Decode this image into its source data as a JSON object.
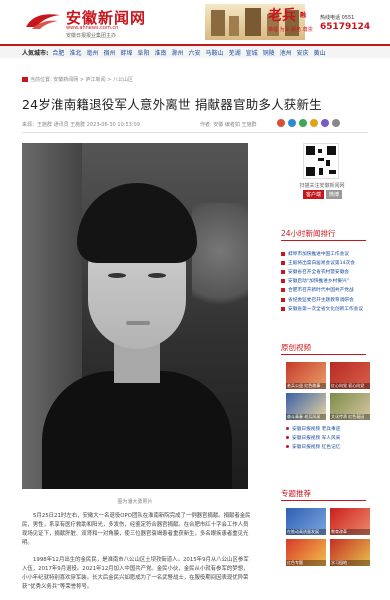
{
  "header": {
    "logo_title": "安徽新闻网",
    "logo_url": "www.ahnews.com.cn",
    "logo_sub": "安徽日报报业集团主办",
    "brand": "老兵",
    "brand_small": "融",
    "brand_sub": "荣福 为军 服务 尊崇",
    "hotline_label": "热线电话 0551",
    "hotline_number": "65179124",
    "accent_color": "#c8161d"
  },
  "region_bar": {
    "label": "人気城市:",
    "items": [
      "合肥",
      "淮北",
      "亳州",
      "宿州",
      "蚌埠",
      "阜阳",
      "淮南",
      "滁州",
      "六安",
      "马鞍山",
      "芜湖",
      "宣城",
      "铜陵",
      "池州",
      "安庆",
      "黄山"
    ]
  },
  "breadcrumb": "当前位置: 安徽新闻网 > 庐江新闻 > 八公山区",
  "article": {
    "title": "24岁淮南籍退役军人意外离世 捐献器官助多人获新生",
    "meta_left": "来源：王施群 通讯员  王施群  2023-06-30 10:53:09",
    "meta_right": "作者: 安徽 编者如 王施群",
    "caption": "图为潘大勇照片",
    "paragraph1": "5月25日21时左右，安徽大一名退役OPO团队在淮南新院完成了一例器官捐献。捐献者金民民，男性，系享有医疗救助和阳光，多发伤，经鉴定符合器官捐献。在合肥市红十字会工作人员现场见证下，捐献肝脏、双肾和一对角膜，使三位器官衰竭患者重获新生，多名眼疾患者重见光明。",
    "paragraph2": "1998年12月出生的金民民，是淮南市八公山区土坝孜街道人。2015年9月从八公山区参军入伍，2017年9月退役。2021年12月加入中国共产党。金民小伙，金民从小就有参军的梦想，小小年纪就特别喜欢穿军装。长大后金民兴如愿成为了一名武警战士，在服役期间因表现优异荣获“优秀义务兵”等荣誉称号。"
  },
  "share_colors": [
    "#d94f3a",
    "#2a8bd6",
    "#3aa854",
    "#e4a11a",
    "#7a5bc8",
    "#888888"
  ],
  "sidebar": {
    "qr_caption": "扫描关注安徽新闻网",
    "qr_button_1": "客户端",
    "qr_button_2": "微博",
    "rank_title": "24小时新闻排行",
    "rank_items": [
      "蚌埠市加快推进中国工作会议",
      "王毅将出席白居易会议第14次会",
      "安徽省召开全省农村暨安徽会",
      "安徽启动“加快推进乡村振兴”",
      "合肥市召开新时代中国共产党战",
      "省纪委监委召开主题教育调研会",
      "安徽省第一次全省文化创新工作会议"
    ],
    "video_title": "原创视频",
    "video_thumbs": [
      {
        "caption": "老兵公益 红色故事",
        "color": "#c63b2c"
      },
      {
        "caption": "红心向党 初心向党",
        "color": "#b72a23"
      },
      {
        "caption": "奋斗青春 老兵风采",
        "color": "#3a5fa8"
      },
      {
        "caption": "文化传承 红色基因",
        "color": "#7d8c4a"
      }
    ],
    "video_items": [
      "安徽日报视频 老兵事迹",
      "安徽日报视频 军人风采",
      "安徽日报视频 红色记忆"
    ],
    "topic_title": "专题推荐",
    "topic_thumbs": [
      {
        "caption": "在推动高质量发展",
        "color": "#2f5fb3"
      },
      {
        "caption": "教育改革",
        "color": "#c8201f"
      },
      {
        "caption": "红色专题",
        "color": "#d83a2a"
      },
      {
        "caption": "学习园地",
        "color": "#c42e24"
      }
    ]
  }
}
